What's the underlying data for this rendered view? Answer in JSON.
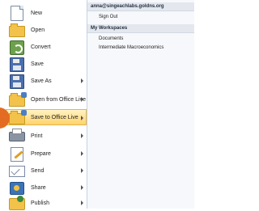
{
  "menu": {
    "items": [
      {
        "label": "New",
        "icon": "new-document-icon",
        "has_submenu": false
      },
      {
        "label": "Open",
        "icon": "open-folder-icon",
        "has_submenu": false
      },
      {
        "label": "Convert",
        "icon": "convert-icon",
        "has_submenu": false
      },
      {
        "label": "Save",
        "icon": "save-icon",
        "has_submenu": false
      },
      {
        "label": "Save As",
        "icon": "save-as-icon",
        "has_submenu": true
      },
      {
        "label": "Open from Office Live",
        "icon": "open-office-live-icon",
        "has_submenu": true
      },
      {
        "label": "Save to Office Live",
        "icon": "save-office-live-icon",
        "has_submenu": true,
        "selected": true
      },
      {
        "label": "Print",
        "icon": "print-icon",
        "has_submenu": true
      },
      {
        "label": "Prepare",
        "icon": "prepare-icon",
        "has_submenu": true
      },
      {
        "label": "Send",
        "icon": "send-icon",
        "has_submenu": true
      },
      {
        "label": "Share",
        "icon": "share-icon",
        "has_submenu": true
      },
      {
        "label": "Publish",
        "icon": "publish-icon",
        "has_submenu": true
      }
    ]
  },
  "submenu": {
    "account": "anna@singeachlabs.goldns.org",
    "sign_out": "Sign Out",
    "workspaces_header": "My Workspaces",
    "workspaces": [
      "Documents",
      "Intermediate Macroeconomics"
    ]
  },
  "colors": {
    "selected_bg": "#ffd36b",
    "step_badge": "#e36c22",
    "header_bg": "#e4e8ee"
  }
}
